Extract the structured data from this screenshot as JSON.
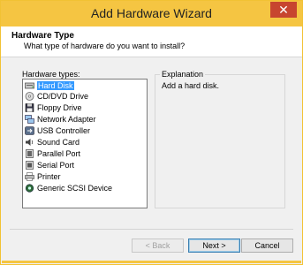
{
  "window": {
    "title": "Add Hardware Wizard",
    "close_glyph": "✕"
  },
  "header": {
    "title": "Hardware Type",
    "subtitle": "What type of hardware do you want to install?"
  },
  "types": {
    "label": "Hardware types:",
    "items": [
      {
        "label": "Hard Disk",
        "icon": "hard-disk-icon",
        "selected": true
      },
      {
        "label": "CD/DVD Drive",
        "icon": "cd-drive-icon"
      },
      {
        "label": "Floppy Drive",
        "icon": "floppy-drive-icon"
      },
      {
        "label": "Network Adapter",
        "icon": "network-adapter-icon"
      },
      {
        "label": "USB Controller",
        "icon": "usb-controller-icon"
      },
      {
        "label": "Sound Card",
        "icon": "sound-card-icon"
      },
      {
        "label": "Parallel Port",
        "icon": "parallel-port-icon"
      },
      {
        "label": "Serial Port",
        "icon": "serial-port-icon"
      },
      {
        "label": "Printer",
        "icon": "printer-icon"
      },
      {
        "label": "Generic SCSI Device",
        "icon": "scsi-device-icon"
      }
    ]
  },
  "explanation": {
    "label": "Explanation",
    "text": "Add a hard disk."
  },
  "buttons": {
    "back": "< Back",
    "next": "Next >",
    "cancel": "Cancel"
  },
  "colors": {
    "titlebar": "#f5c542",
    "close": "#c7452f",
    "selection": "#3399ff"
  }
}
